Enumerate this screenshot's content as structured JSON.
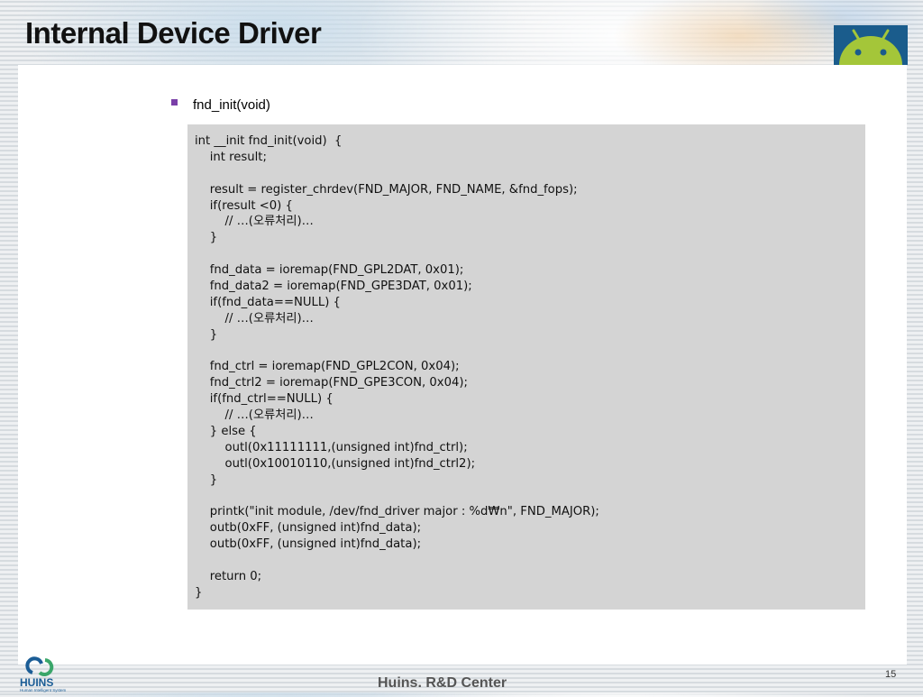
{
  "slide": {
    "title": "Internal Device Driver",
    "bullet": "fnd_init(void)",
    "page_number": "15",
    "footer": "Huins. R&D Center",
    "logo_text": "HUINS",
    "logo_subtext": "Human Intelligent System"
  },
  "code_lines": [
    "int __init fnd_init(void)  {",
    "    int result;",
    "",
    "    result = register_chrdev(FND_MAJOR, FND_NAME, &fnd_fops);",
    "    if(result <0) {",
    "        // …(오류처리)…",
    "    }",
    "",
    "    fnd_data = ioremap(FND_GPL2DAT, 0x01);",
    "    fnd_data2 = ioremap(FND_GPE3DAT, 0x01);",
    "    if(fnd_data==NULL) {",
    "        // …(오류처리)…",
    "    }",
    "",
    "    fnd_ctrl = ioremap(FND_GPL2CON, 0x04);",
    "    fnd_ctrl2 = ioremap(FND_GPE3CON, 0x04);",
    "    if(fnd_ctrl==NULL) {",
    "        // …(오류처리)…",
    "    } else {",
    "        outl(0x11111111,(unsigned int)fnd_ctrl);",
    "        outl(0x10010110,(unsigned int)fnd_ctrl2);",
    "    }",
    "",
    "    printk(\"init module, /dev/fnd_driver major : %d₩n\", FND_MAJOR);",
    "    outb(0xFF, (unsigned int)fnd_data);",
    "    outb(0xFF, (unsigned int)fnd_data);",
    "",
    "    return 0;",
    "}"
  ],
  "colors": {
    "bullet": "#7a3fa8",
    "code_background": "#d4d4d4",
    "android_green": "#a4c639",
    "android_bg": "#1a5c8c",
    "logo_blue": "#1b5d96",
    "logo_green": "#3aa66a"
  },
  "icons": [
    "android-logo-icon",
    "huins-logo-icon"
  ]
}
